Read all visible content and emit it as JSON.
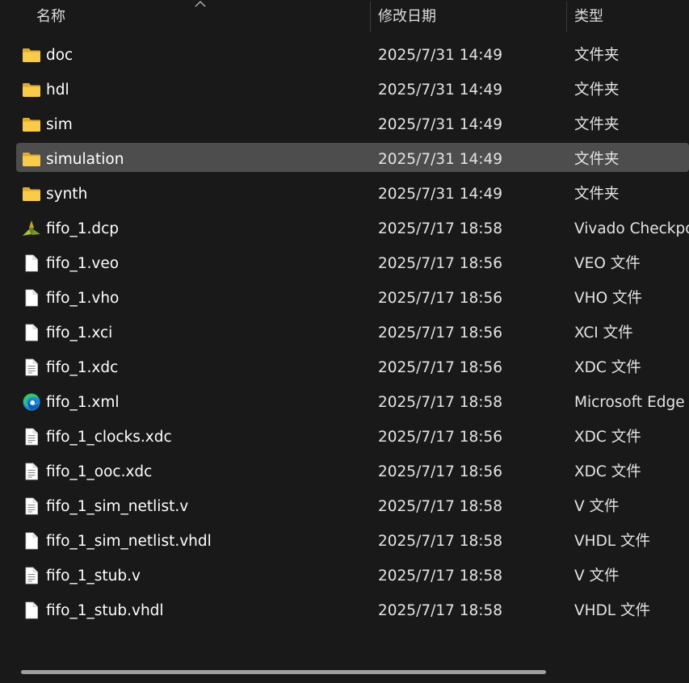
{
  "columns": {
    "name": "名称",
    "date": "修改日期",
    "type": "类型"
  },
  "files": [
    {
      "name": "doc",
      "date": "2025/7/31 14:49",
      "type": "文件夹",
      "icon": "folder-icon"
    },
    {
      "name": "hdl",
      "date": "2025/7/31 14:49",
      "type": "文件夹",
      "icon": "folder-icon"
    },
    {
      "name": "sim",
      "date": "2025/7/31 14:49",
      "type": "文件夹",
      "icon": "folder-icon"
    },
    {
      "name": "simulation",
      "date": "2025/7/31 14:49",
      "type": "文件夹",
      "icon": "folder-icon",
      "selected": true
    },
    {
      "name": "synth",
      "date": "2025/7/31 14:49",
      "type": "文件夹",
      "icon": "folder-icon"
    },
    {
      "name": "fifo_1.dcp",
      "date": "2025/7/17 18:58",
      "type": "Vivado Checkpoi",
      "icon": "vivado-icon"
    },
    {
      "name": "fifo_1.veo",
      "date": "2025/7/17 18:56",
      "type": "VEO 文件",
      "icon": "file-icon"
    },
    {
      "name": "fifo_1.vho",
      "date": "2025/7/17 18:56",
      "type": "VHO 文件",
      "icon": "file-icon"
    },
    {
      "name": "fifo_1.xci",
      "date": "2025/7/17 18:56",
      "type": "XCI 文件",
      "icon": "file-icon"
    },
    {
      "name": "fifo_1.xdc",
      "date": "2025/7/17 18:56",
      "type": "XDC 文件",
      "icon": "text-file-icon"
    },
    {
      "name": "fifo_1.xml",
      "date": "2025/7/17 18:58",
      "type": "Microsoft Edge H",
      "icon": "edge-icon"
    },
    {
      "name": "fifo_1_clocks.xdc",
      "date": "2025/7/17 18:56",
      "type": "XDC 文件",
      "icon": "text-file-icon"
    },
    {
      "name": "fifo_1_ooc.xdc",
      "date": "2025/7/17 18:56",
      "type": "XDC 文件",
      "icon": "text-file-icon"
    },
    {
      "name": "fifo_1_sim_netlist.v",
      "date": "2025/7/17 18:58",
      "type": "V 文件",
      "icon": "text-file-icon"
    },
    {
      "name": "fifo_1_sim_netlist.vhdl",
      "date": "2025/7/17 18:58",
      "type": "VHDL 文件",
      "icon": "file-icon"
    },
    {
      "name": "fifo_1_stub.v",
      "date": "2025/7/17 18:58",
      "type": "V 文件",
      "icon": "text-file-icon"
    },
    {
      "name": "fifo_1_stub.vhdl",
      "date": "2025/7/17 18:58",
      "type": "VHDL 文件",
      "icon": "file-icon"
    }
  ],
  "colors": {
    "background": "#191919",
    "selection": "#4d4d4d",
    "folder": "#f6c944",
    "text": "#ffffff"
  }
}
